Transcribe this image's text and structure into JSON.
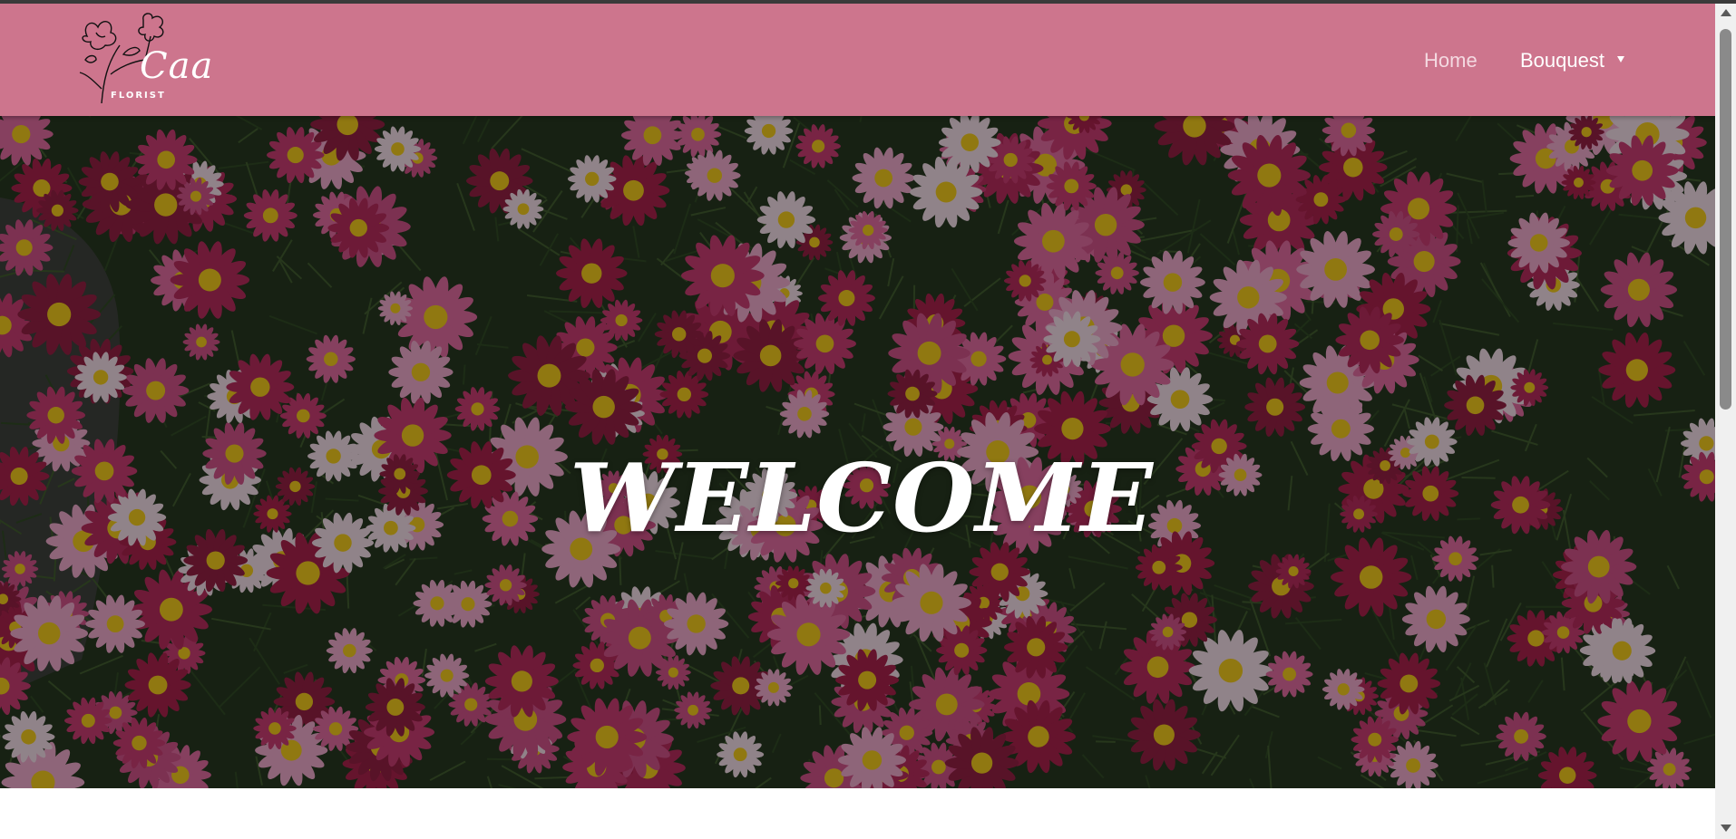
{
  "brand": {
    "name": "Caa",
    "tagline": "FLORIST"
  },
  "nav": {
    "home_label": "Home",
    "bouquet_label": "Bouquest"
  },
  "hero": {
    "title": "WELCOME"
  },
  "colors": {
    "navbar": "#cd758d",
    "home_link": "#f4d9e1",
    "link": "#ffffff"
  },
  "icons": {
    "dropdown": "caret-down-icon",
    "logo": "flower-logo-icon"
  }
}
